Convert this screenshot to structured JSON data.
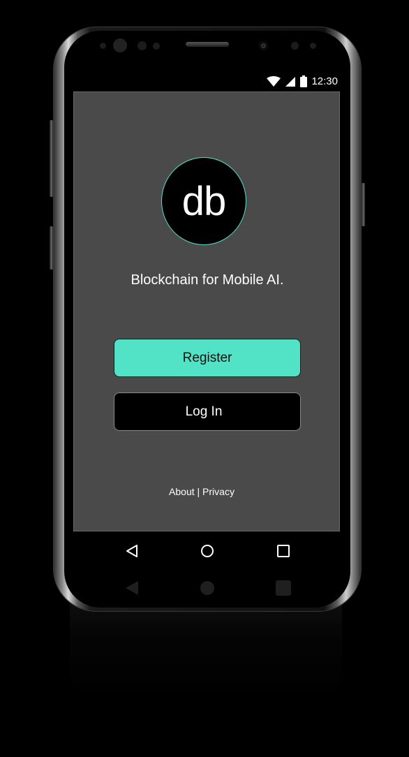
{
  "status_bar": {
    "time": "12:30",
    "icons": [
      "wifi-icon",
      "cell-signal-icon",
      "battery-icon"
    ]
  },
  "app": {
    "logo_text": "db",
    "tagline": "Blockchain for Mobile AI.",
    "register_label": "Register",
    "login_label": "Log In",
    "about_label": "About",
    "separator": "|",
    "privacy_label": "Privacy"
  },
  "nav_bar": {
    "icons": [
      "back-icon",
      "home-icon",
      "recents-icon"
    ]
  },
  "colors": {
    "accent": "#52e3c6",
    "screen_bg": "#4a4a4a",
    "button_dark": "#000000"
  }
}
